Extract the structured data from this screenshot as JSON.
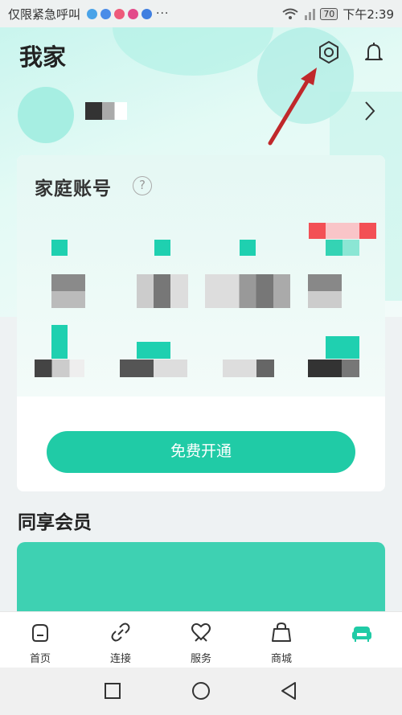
{
  "status_bar": {
    "carrier": "仅限紧急呼叫",
    "more": "···",
    "battery": "70",
    "time": "下午2:39"
  },
  "header": {
    "title": "我家"
  },
  "icons": {
    "settings": "settings-icon",
    "notification": "bell-icon",
    "chevron": "chevron-right-icon",
    "help": "help-icon"
  },
  "profile": {
    "name": "■ 6"
  },
  "family_card": {
    "title": "家庭账号",
    "help_glyph": "?",
    "open_button": "免费开通"
  },
  "shared_members": {
    "title": "同享会员"
  },
  "bottom_nav": {
    "items": [
      {
        "label": "首页",
        "icon": "home-icon"
      },
      {
        "label": "连接",
        "icon": "link-icon"
      },
      {
        "label": "服务",
        "icon": "heart-hands-icon"
      },
      {
        "label": "商城",
        "icon": "shopping-bag-icon"
      },
      {
        "label": "",
        "icon": "sofa-icon"
      }
    ]
  },
  "colors": {
    "accent": "#20cba6",
    "annotation_arrow": "#c0282b"
  }
}
